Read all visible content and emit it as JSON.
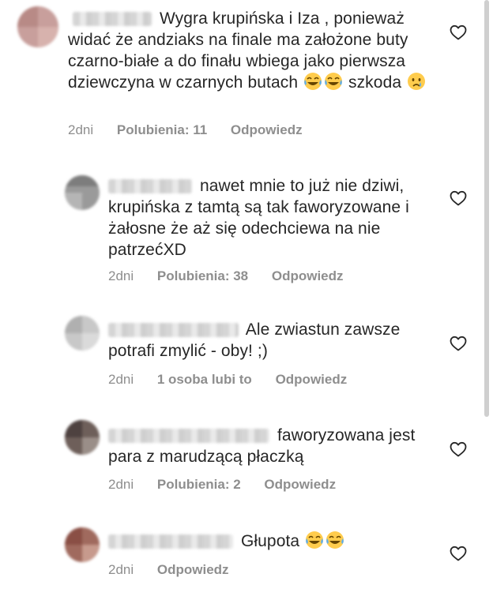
{
  "comments": [
    {
      "text": "Wygra krupińska i Iza , ponieważ widać że andziaks na finale ma założone buty czarno-białe a do finału wbiega jako pierwsza dziewczyna w czarnych butach",
      "text_tail": "szkoda",
      "time": "2dni",
      "likes": "Polubienia: 11",
      "reply": "Odpowiedz"
    },
    {
      "text": "nawet mnie to już nie dziwi, krupińska z tamtą są tak faworyzowane i żałosne że aż się odechciewa na nie patrzećXD",
      "time": "2dni",
      "likes": "Polubienia: 38",
      "reply": "Odpowiedz"
    },
    {
      "text": "Ale zwiastun zawsze potrafi zmylić - oby! ;)",
      "time": "2dni",
      "likes": "1 osoba lubi to",
      "reply": "Odpowiedz"
    },
    {
      "text": "faworyzowana jest para z marudzącą płaczką",
      "time": "2dni",
      "likes": "Polubienia: 2",
      "reply": "Odpowiedz"
    },
    {
      "text": "Głupota",
      "time": "2dni",
      "reply": "Odpowiedz"
    }
  ],
  "icons": {
    "like": "heart-outline-icon",
    "laugh": "face-with-tears-of-joy-emoji",
    "cry": "crying-face-emoji"
  },
  "colors": {
    "text": "#262626",
    "meta": "#8e8e8e",
    "background": "#ffffff"
  }
}
